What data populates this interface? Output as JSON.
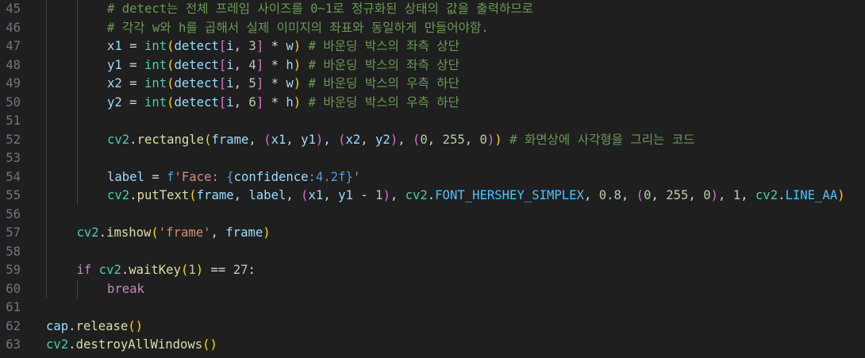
{
  "editor": {
    "language": "python",
    "colors": {
      "background": "#1f1f1f",
      "line_number": "#6e7681",
      "keyword": "#c586c0",
      "variable": "#9cdcfe",
      "function": "#dcdcaa",
      "number": "#b5cea8",
      "string": "#ce9178",
      "comment": "#6a9955"
    },
    "lines": [
      {
        "num": "45",
        "indent": 2,
        "tokens": [
          [
            "cmt",
            "# detect는 전체 프레임 사이즈를 0~1로 정규화된 상태의 값을 출력하므로"
          ]
        ]
      },
      {
        "num": "46",
        "indent": 2,
        "tokens": [
          [
            "cmt",
            "# 각각 w와 h를 곱해서 실제 이미지의 좌표와 동일하게 만들어야함."
          ]
        ]
      },
      {
        "num": "47",
        "indent": 2,
        "tokens": [
          [
            "var",
            "x1"
          ],
          [
            "op",
            " = "
          ],
          [
            "cls",
            "int"
          ],
          [
            "br1",
            "("
          ],
          [
            "var",
            "detect"
          ],
          [
            "br2",
            "["
          ],
          [
            "var",
            "i"
          ],
          [
            "op",
            ", "
          ],
          [
            "num",
            "3"
          ],
          [
            "br2",
            "]"
          ],
          [
            "op",
            " * "
          ],
          [
            "var",
            "w"
          ],
          [
            "br1",
            ")"
          ],
          [
            "op",
            " "
          ],
          [
            "cmt",
            "# 바운딩 박스의 좌측 상단"
          ]
        ]
      },
      {
        "num": "48",
        "indent": 2,
        "tokens": [
          [
            "var",
            "y1"
          ],
          [
            "op",
            " = "
          ],
          [
            "cls",
            "int"
          ],
          [
            "br1",
            "("
          ],
          [
            "var",
            "detect"
          ],
          [
            "br2",
            "["
          ],
          [
            "var",
            "i"
          ],
          [
            "op",
            ", "
          ],
          [
            "num",
            "4"
          ],
          [
            "br2",
            "]"
          ],
          [
            "op",
            " * "
          ],
          [
            "var",
            "h"
          ],
          [
            "br1",
            ")"
          ],
          [
            "op",
            " "
          ],
          [
            "cmt",
            "# 바운딩 박스의 좌측 상단"
          ]
        ]
      },
      {
        "num": "49",
        "indent": 2,
        "tokens": [
          [
            "var",
            "x2"
          ],
          [
            "op",
            " = "
          ],
          [
            "cls",
            "int"
          ],
          [
            "br1",
            "("
          ],
          [
            "var",
            "detect"
          ],
          [
            "br2",
            "["
          ],
          [
            "var",
            "i"
          ],
          [
            "op",
            ", "
          ],
          [
            "num",
            "5"
          ],
          [
            "br2",
            "]"
          ],
          [
            "op",
            " * "
          ],
          [
            "var",
            "w"
          ],
          [
            "br1",
            ")"
          ],
          [
            "op",
            " "
          ],
          [
            "cmt",
            "# 바운딩 박스의 우측 하단"
          ]
        ]
      },
      {
        "num": "50",
        "indent": 2,
        "tokens": [
          [
            "var",
            "y2"
          ],
          [
            "op",
            " = "
          ],
          [
            "cls",
            "int"
          ],
          [
            "br1",
            "("
          ],
          [
            "var",
            "detect"
          ],
          [
            "br2",
            "["
          ],
          [
            "var",
            "i"
          ],
          [
            "op",
            ", "
          ],
          [
            "num",
            "6"
          ],
          [
            "br2",
            "]"
          ],
          [
            "op",
            " * "
          ],
          [
            "var",
            "h"
          ],
          [
            "br1",
            ")"
          ],
          [
            "op",
            " "
          ],
          [
            "cmt",
            "# 바운딩 박스의 우측 하단"
          ]
        ]
      },
      {
        "num": "51",
        "indent": 2,
        "tokens": []
      },
      {
        "num": "52",
        "indent": 2,
        "tokens": [
          [
            "cls",
            "cv2"
          ],
          [
            "op",
            "."
          ],
          [
            "fn",
            "rectangle"
          ],
          [
            "br1",
            "("
          ],
          [
            "var",
            "frame"
          ],
          [
            "op",
            ", "
          ],
          [
            "br2",
            "("
          ],
          [
            "var",
            "x1"
          ],
          [
            "op",
            ", "
          ],
          [
            "var",
            "y1"
          ],
          [
            "br2",
            ")"
          ],
          [
            "op",
            ", "
          ],
          [
            "br2",
            "("
          ],
          [
            "var",
            "x2"
          ],
          [
            "op",
            ", "
          ],
          [
            "var",
            "y2"
          ],
          [
            "br2",
            ")"
          ],
          [
            "op",
            ", "
          ],
          [
            "br2",
            "("
          ],
          [
            "num",
            "0"
          ],
          [
            "op",
            ", "
          ],
          [
            "num",
            "255"
          ],
          [
            "op",
            ", "
          ],
          [
            "num",
            "0"
          ],
          [
            "br2",
            ")"
          ],
          [
            "br1",
            ")"
          ],
          [
            "op",
            " "
          ],
          [
            "cmt",
            "# 화면상에 사각형을 그리는 코드"
          ]
        ]
      },
      {
        "num": "53",
        "indent": 2,
        "tokens": []
      },
      {
        "num": "54",
        "indent": 2,
        "tokens": [
          [
            "var",
            "label"
          ],
          [
            "op",
            " = "
          ],
          [
            "fmt",
            "f"
          ],
          [
            "str",
            "'Face: "
          ],
          [
            "fmt",
            "{"
          ],
          [
            "var",
            "confidence"
          ],
          [
            "fmt",
            ":4.2f"
          ],
          [
            "fmt",
            "}"
          ],
          [
            "str",
            "'"
          ]
        ]
      },
      {
        "num": "55",
        "indent": 2,
        "tokens": [
          [
            "cls",
            "cv2"
          ],
          [
            "op",
            "."
          ],
          [
            "fn",
            "putText"
          ],
          [
            "br1",
            "("
          ],
          [
            "var",
            "frame"
          ],
          [
            "op",
            ", "
          ],
          [
            "var",
            "label"
          ],
          [
            "op",
            ", "
          ],
          [
            "br2",
            "("
          ],
          [
            "var",
            "x1"
          ],
          [
            "op",
            ", "
          ],
          [
            "var",
            "y1"
          ],
          [
            "op",
            " - "
          ],
          [
            "num",
            "1"
          ],
          [
            "br2",
            ")"
          ],
          [
            "op",
            ", "
          ],
          [
            "cls",
            "cv2"
          ],
          [
            "op",
            "."
          ],
          [
            "const",
            "FONT_HERSHEY_SIMPLEX"
          ],
          [
            "op",
            ", "
          ],
          [
            "num",
            "0.8"
          ],
          [
            "op",
            ", "
          ],
          [
            "br2",
            "("
          ],
          [
            "num",
            "0"
          ],
          [
            "op",
            ", "
          ],
          [
            "num",
            "255"
          ],
          [
            "op",
            ", "
          ],
          [
            "num",
            "0"
          ],
          [
            "br2",
            ")"
          ],
          [
            "op",
            ", "
          ],
          [
            "num",
            "1"
          ],
          [
            "op",
            ", "
          ],
          [
            "cls",
            "cv2"
          ],
          [
            "op",
            "."
          ],
          [
            "const",
            "LINE_AA"
          ],
          [
            "br1",
            ")"
          ]
        ]
      },
      {
        "num": "56",
        "indent": 1,
        "tokens": []
      },
      {
        "num": "57",
        "indent": 1,
        "tokens": [
          [
            "cls",
            "cv2"
          ],
          [
            "op",
            "."
          ],
          [
            "fn",
            "imshow"
          ],
          [
            "br1",
            "("
          ],
          [
            "str",
            "'frame'"
          ],
          [
            "op",
            ", "
          ],
          [
            "var",
            "frame"
          ],
          [
            "br1",
            ")"
          ]
        ]
      },
      {
        "num": "58",
        "indent": 1,
        "tokens": []
      },
      {
        "num": "59",
        "indent": 1,
        "tokens": [
          [
            "kw",
            "if"
          ],
          [
            "op",
            " "
          ],
          [
            "cls",
            "cv2"
          ],
          [
            "op",
            "."
          ],
          [
            "fn",
            "waitKey"
          ],
          [
            "br1",
            "("
          ],
          [
            "num",
            "1"
          ],
          [
            "br1",
            ")"
          ],
          [
            "op",
            " == "
          ],
          [
            "num",
            "27"
          ],
          [
            "op",
            ":"
          ]
        ]
      },
      {
        "num": "60",
        "indent": 2,
        "tokens": [
          [
            "kw",
            "break"
          ]
        ]
      },
      {
        "num": "61",
        "indent": 0,
        "tokens": []
      },
      {
        "num": "62",
        "indent": 0,
        "tokens": [
          [
            "var",
            "cap"
          ],
          [
            "op",
            "."
          ],
          [
            "fn",
            "release"
          ],
          [
            "br1",
            "()"
          ]
        ]
      },
      {
        "num": "63",
        "indent": 0,
        "tokens": [
          [
            "cls",
            "cv2"
          ],
          [
            "op",
            "."
          ],
          [
            "fn",
            "destroyAllWindows"
          ],
          [
            "br1",
            "()"
          ]
        ]
      }
    ]
  }
}
